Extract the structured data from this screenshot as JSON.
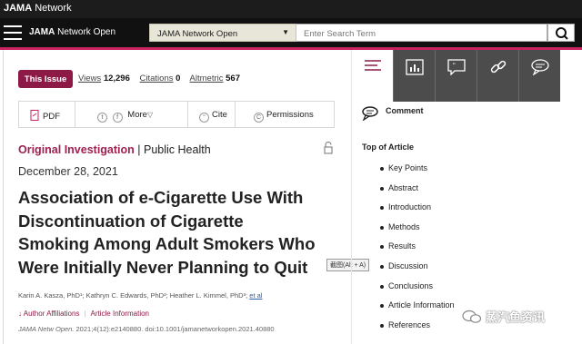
{
  "topbar": {
    "brand_bold": "JAMA",
    "brand_rest": " Network"
  },
  "header": {
    "journal_bold": "JAMA",
    "journal_rest": " Network Open",
    "select_value": "JAMA Network Open",
    "search_placeholder": "Enter Search Term"
  },
  "article_meta": {
    "issue_label": "This Issue",
    "views_label": "Views",
    "views_value": "12,296",
    "citations_label": "Citations",
    "citations_value": "0",
    "altmetric_label": "Altmetric",
    "altmetric_value": "567"
  },
  "toolbar": {
    "pdf_label": "PDF",
    "more_label": "More",
    "cite_label": "Cite",
    "permissions_label": "Permissions"
  },
  "article": {
    "category": "Original Investigation",
    "separator": " | ",
    "subject": "Public Health",
    "date": "December 28, 2021",
    "title_lines": [
      "Association of e-Cigarette Use With",
      "Discontinuation of Cigarette",
      "Smoking Among Adult Smokers Who",
      "Were Initially Never Planning to Quit"
    ],
    "tooltip": "截图(Alt + A)",
    "authors": "Karin A. Kasza, PhD¹; Kathryn C. Edwards, PhD²; Heather L. Kimmel, PhD³;",
    "et_al": "et al",
    "author_affiliations": "↓ Author Affiliations",
    "article_information": "Article Information",
    "citation_journal": "JAMA Netw Open.",
    "citation_rest": " 2021;4(12):e2140880. doi:10.1001/jamanetworkopen.2021.40880"
  },
  "sidebar": {
    "comment_label": "Comment",
    "toc_heading": "Top of Article",
    "toc_items": [
      "Key Points",
      "Abstract",
      "Introduction",
      "Methods",
      "Results",
      "Discussion",
      "Conclusions",
      "Article Information",
      "References"
    ]
  },
  "watermark": {
    "text": "蒸汽鱼资讯"
  },
  "colors": {
    "brand": "#c8235f",
    "issue_button": "#8d1a46",
    "tab_dark": "#4c4c4c"
  }
}
